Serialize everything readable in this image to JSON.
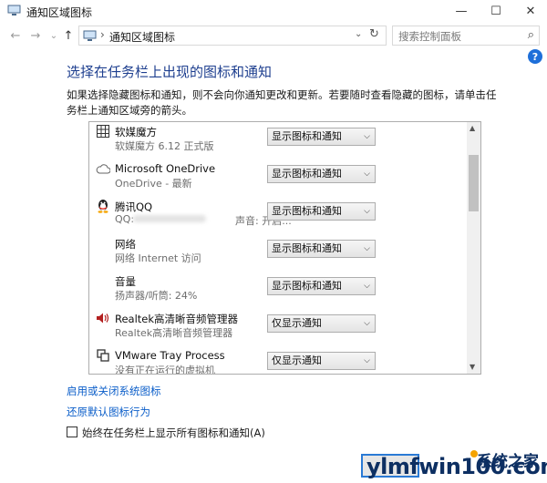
{
  "window": {
    "title": "通知区域图标",
    "min_glyph": "—",
    "max_glyph": "☐",
    "close_glyph": "✕"
  },
  "address": {
    "back_glyph": "←",
    "forward_glyph": "→",
    "up_glyph": "↑",
    "separator": "›",
    "crumb": "通知区域图标",
    "dropdown_glyph": "⌄",
    "refresh_glyph": "↻",
    "search_placeholder": "搜索控制面板",
    "search_glyph": "⌕"
  },
  "help": {
    "glyph": "?"
  },
  "content": {
    "heading": "选择在任务栏上出现的图标和通知",
    "description": "如果选择隐藏图标和通知，则不会向你通知更改和更新。若要随时查看隐藏的图标，请单击任务栏上通知区域旁的箭头。"
  },
  "rows": [
    {
      "icon": "grid-icon",
      "name": "软媒魔方",
      "sub": "软媒魔方 6.12 正式版",
      "sub2": "",
      "option": "显示图标和通知"
    },
    {
      "icon": "cloud-icon",
      "name": "Microsoft OneDrive",
      "sub": "OneDrive - 最新",
      "sub2": "",
      "option": "显示图标和通知"
    },
    {
      "icon": "qq-penguin-icon",
      "name": "腾讯QQ",
      "sub": "QQ:",
      "sub2": "声音: 开启...",
      "option": "显示图标和通知"
    },
    {
      "icon": "",
      "name": "网络",
      "sub": "网络 Internet 访问",
      "sub2": "",
      "option": "显示图标和通知"
    },
    {
      "icon": "",
      "name": "音量",
      "sub": "扬声器/听筒: 24%",
      "sub2": "",
      "option": "显示图标和通知"
    },
    {
      "icon": "speaker-icon",
      "name": "Realtek高清晰音频管理器",
      "sub": "Realtek高清晰音频管理器",
      "sub2": "",
      "option": "仅显示通知"
    },
    {
      "icon": "vmware-icon",
      "name": "VMware Tray Process",
      "sub": "没有正在运行的虚拟机",
      "sub2": "",
      "option": "仅显示通知"
    }
  ],
  "links": {
    "toggle_system_icons": "启用或关闭系统图标",
    "restore_defaults": "还原默认图标行为"
  },
  "checkbox": {
    "label": "始终在任务栏上显示所有图标和通知(A)",
    "checked": false
  },
  "watermark": {
    "text": "ylmfwin100.com",
    "cn": "系统之家"
  }
}
